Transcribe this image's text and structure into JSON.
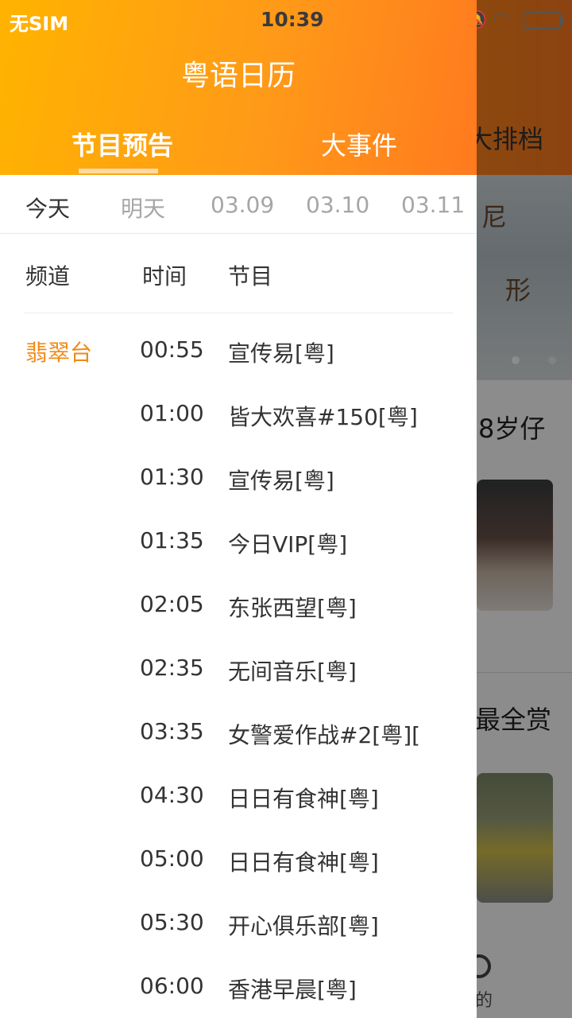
{
  "status_bar": {
    "carrier": "无SIM",
    "time": "10:39",
    "icons": [
      "bell-off-icon",
      "wifi-icon",
      "battery-icon"
    ]
  },
  "background": {
    "tab_partial": "大排档",
    "banner_text_1": "尼",
    "banner_text_2": "形",
    "article_title_1": "8岁仔",
    "article_title_2": "最全赏",
    "bottom_nav_label": "的"
  },
  "drawer": {
    "title": "粤语日历",
    "tabs": [
      {
        "label": "节目预告",
        "active": true
      },
      {
        "label": "大事件",
        "active": false
      }
    ],
    "dates": [
      {
        "label": "今天",
        "active": true
      },
      {
        "label": "明天",
        "active": false
      },
      {
        "label": "03.09",
        "active": false
      },
      {
        "label": "03.10",
        "active": false
      },
      {
        "label": "03.11",
        "active": false
      }
    ],
    "columns": {
      "channel": "频道",
      "time": "时间",
      "program": "节目"
    },
    "channel_name": "翡翠台",
    "programs": [
      {
        "time": "00:55",
        "name": "宣传易[粤]"
      },
      {
        "time": "01:00",
        "name": "皆大欢喜#150[粤]"
      },
      {
        "time": "01:30",
        "name": "宣传易[粤]"
      },
      {
        "time": "01:35",
        "name": "今日VIP[粤]"
      },
      {
        "time": "02:05",
        "name": "东张西望[粤]"
      },
      {
        "time": "02:35",
        "name": "无间音乐[粤]"
      },
      {
        "time": "03:35",
        "name": "女警爱作战#2[粤]["
      },
      {
        "time": "04:30",
        "name": "日日有食神[粤]"
      },
      {
        "time": "05:00",
        "name": "日日有食神[粤]"
      },
      {
        "time": "05:30",
        "name": "开心俱乐部[粤]"
      },
      {
        "time": "06:00",
        "name": "香港早晨[粤]"
      }
    ]
  },
  "colors": {
    "header_gradient_start": "#ffb300",
    "header_gradient_end": "#ff7a1f",
    "channel_accent": "#ef8a16",
    "inactive_date": "#a6a6a6"
  }
}
